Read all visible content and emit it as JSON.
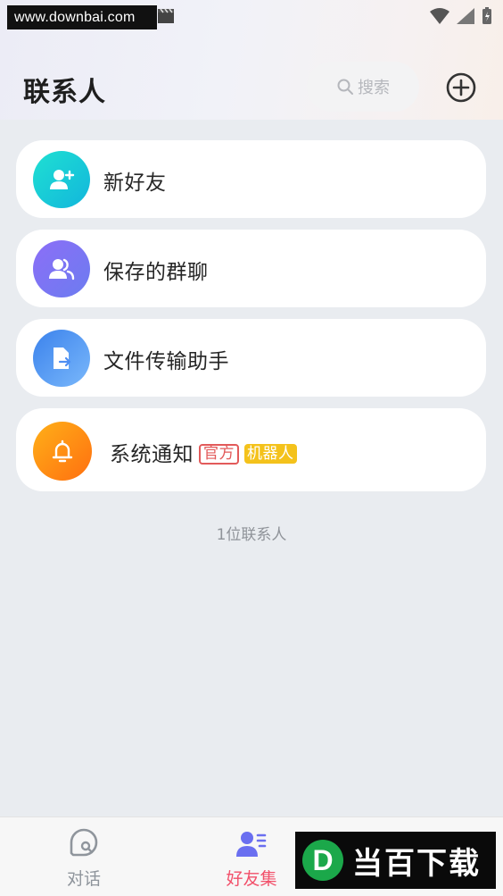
{
  "watermark": {
    "text": "www.downbai.com"
  },
  "header": {
    "title": "联系人",
    "search_placeholder": "搜索"
  },
  "contacts": [
    {
      "label": "新好友",
      "icon": "add-user-icon",
      "color": "#19cfd6"
    },
    {
      "label": "保存的群聊",
      "icon": "group-icon",
      "color": "#7b6cf0"
    },
    {
      "label": "文件传输助手",
      "icon": "file-transfer-icon",
      "color": "#4f8ff3"
    },
    {
      "label": "系统通知",
      "icon": "bell-icon",
      "color": "#ff8a10",
      "tags": {
        "official": "官方",
        "robot": "机器人"
      }
    }
  ],
  "contact_count": "1位联系人",
  "tabbar": {
    "items": [
      {
        "label": "对话",
        "icon": "chat-icon",
        "active": false
      },
      {
        "label": "好友集",
        "icon": "contacts-icon",
        "active": true
      }
    ]
  },
  "brand_watermark": {
    "letter": "D",
    "text": "当百下载"
  },
  "colors": {
    "active_tab": "#f2506a",
    "inactive_tab": "#8f959c",
    "accent_tag": "#e25a5a"
  }
}
